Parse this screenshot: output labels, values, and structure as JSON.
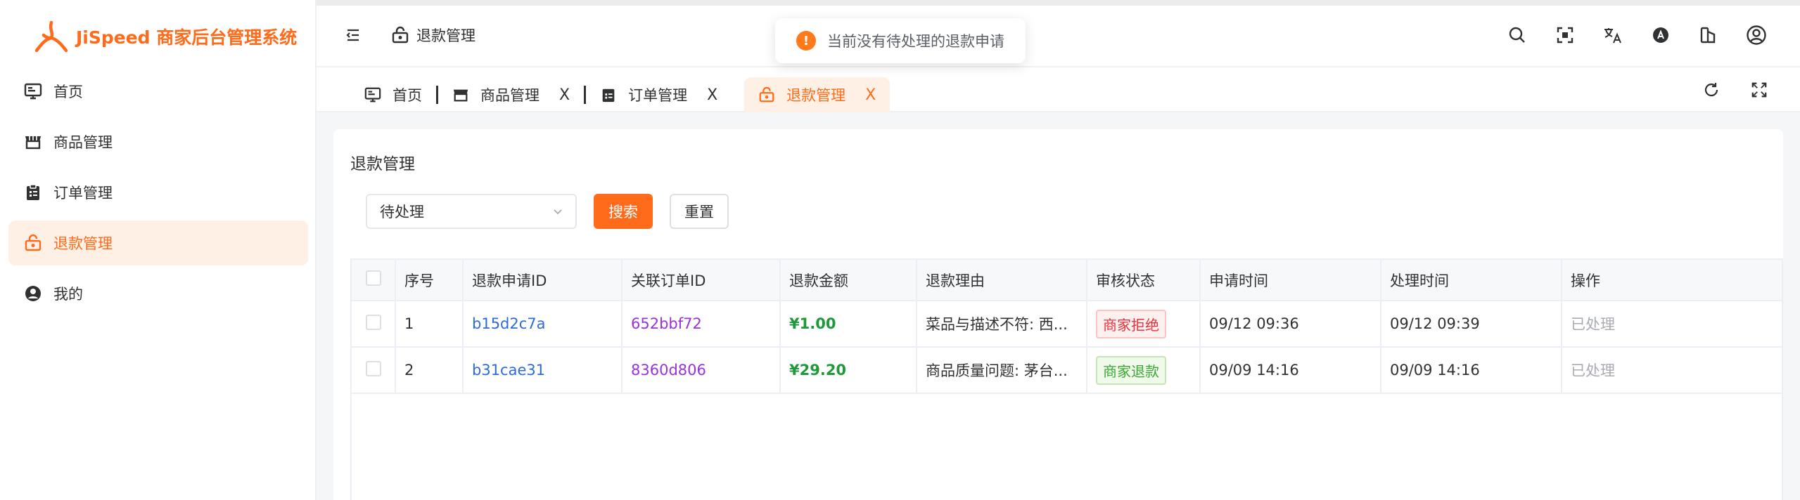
{
  "app": {
    "logo_text": "JiSpeed 商家后台管理系统",
    "brand_color": "#ff6b1a"
  },
  "sidebar": {
    "items": [
      {
        "label": "首页",
        "icon": "monitor-icon",
        "active": false
      },
      {
        "label": "商品管理",
        "icon": "store-icon",
        "active": false
      },
      {
        "label": "订单管理",
        "icon": "clipboard-icon",
        "active": false
      },
      {
        "label": "退款管理",
        "icon": "refund-icon",
        "active": true
      },
      {
        "label": "我的",
        "icon": "user-circle-icon",
        "active": false
      }
    ]
  },
  "header": {
    "page_title": "退款管理",
    "icons": [
      "search-icon",
      "fullscreen-icon",
      "translate-icon",
      "theme-icon",
      "layout-icon",
      "user-icon"
    ]
  },
  "toast": {
    "message": "当前没有待处理的退款申请",
    "icon_glyph": "!"
  },
  "tabs": [
    {
      "label": "首页",
      "closable": false,
      "active": false
    },
    {
      "label": "商品管理",
      "closable": true,
      "active": false
    },
    {
      "label": "订单管理",
      "closable": true,
      "active": false
    },
    {
      "label": "退款管理",
      "closable": true,
      "active": true
    }
  ],
  "tab_close_glyph": "X",
  "card": {
    "title": "退款管理"
  },
  "filter": {
    "status_value": "待处理",
    "search_label": "搜索",
    "reset_label": "重置"
  },
  "table": {
    "columns": [
      "序号",
      "退款申请ID",
      "关联订单ID",
      "退款金额",
      "退款理由",
      "审核状态",
      "申请时间",
      "处理时间",
      "操作"
    ],
    "rows": [
      {
        "index": "1",
        "refund_id": "b15d2c7a",
        "order_id": "652bbf72",
        "amount": "¥1.00",
        "reason": "菜品与描述不符: 西...",
        "status": "商家拒绝",
        "status_type": "reject",
        "apply_time": "09/12 09:36",
        "process_time": "09/12 09:39",
        "action": "已处理"
      },
      {
        "index": "2",
        "refund_id": "b31cae31",
        "order_id": "8360d806",
        "amount": "¥29.20",
        "reason": "商品质量问题: 茅台...",
        "status": "商家退款",
        "status_type": "refund",
        "apply_time": "09/09 14:16",
        "process_time": "09/09 14:16",
        "action": "已处理"
      }
    ]
  }
}
